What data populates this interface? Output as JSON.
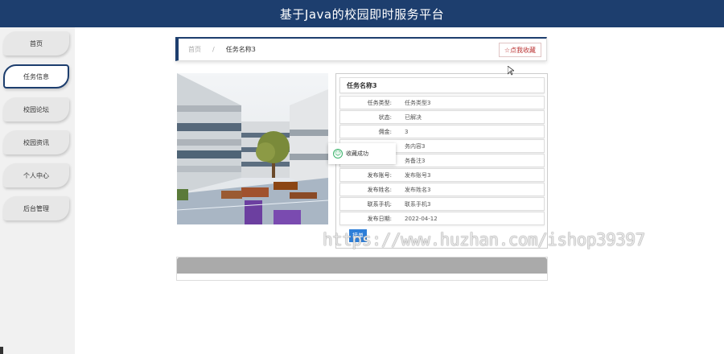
{
  "header": {
    "title": "基于Java的校园即时服务平台"
  },
  "sidebar": {
    "items": [
      {
        "label": "首页"
      },
      {
        "label": "任务信息"
      },
      {
        "label": "校园论坛"
      },
      {
        "label": "校园资讯"
      },
      {
        "label": "个人中心"
      },
      {
        "label": "后台管理"
      }
    ],
    "active_index": 1
  },
  "breadcrumb": {
    "home": "首页",
    "separator": "/",
    "current": "任务名称3"
  },
  "favorite_button": {
    "icon": "star-icon",
    "label": "☆点我收藏"
  },
  "detail": {
    "title": "任务名称3",
    "rows": [
      {
        "key": "任务类型:",
        "value": "任务类型3"
      },
      {
        "key": "状态:",
        "value": "已解决"
      },
      {
        "key": "佣金:",
        "value": "3"
      },
      {
        "key": "",
        "value": "务内容3"
      },
      {
        "key": "",
        "value": "务备注3"
      },
      {
        "key": "发布账号:",
        "value": "发布账号3"
      },
      {
        "key": "发布姓名:",
        "value": "发布姓名3"
      },
      {
        "key": "联系手机:",
        "value": "联系手机3"
      },
      {
        "key": "发布日期:",
        "value": "2022-04-12"
      }
    ],
    "action_label": "接单"
  },
  "toast": {
    "icon": "smile-icon",
    "message": "收藏成功"
  },
  "watermark": "https://www.huzhan.com/ishop39397",
  "colors": {
    "primary": "#1d3e6e",
    "accent_button": "#2d7ed8",
    "success": "#3ab36b",
    "comment_header": "#aaaaaa"
  }
}
